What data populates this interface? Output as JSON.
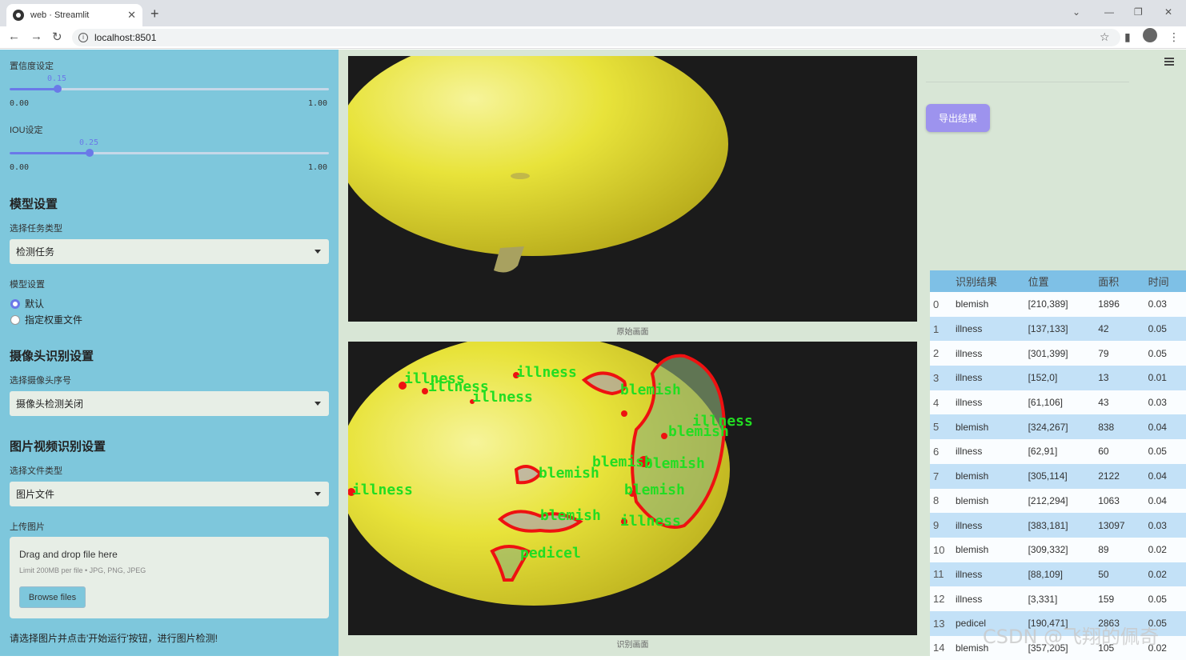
{
  "browser": {
    "tab_title": "web · Streamlit",
    "url": "localhost:8501"
  },
  "sidebar": {
    "confidence": {
      "label": "置信度设定",
      "value": 0.15,
      "value_text": "0.15",
      "min": "0.00",
      "max": "1.00"
    },
    "iou": {
      "label": "IOU设定",
      "value": 0.25,
      "value_text": "0.25",
      "min": "0.00",
      "max": "1.00"
    },
    "model_section": {
      "title": "模型设置",
      "task_label": "选择任务类型",
      "task_value": "检测任务",
      "weights_label": "模型设置",
      "options": [
        "默认",
        "指定权重文件"
      ],
      "selected": 0
    },
    "camera_section": {
      "title": "摄像头识别设置",
      "camera_label": "选择摄像头序号",
      "camera_value": "摄像头检测关闭"
    },
    "media_section": {
      "title": "图片视频识别设置",
      "file_type_label": "选择文件类型",
      "file_type_value": "图片文件",
      "upload_label": "上传图片",
      "upload_drag": "Drag and drop file here",
      "upload_limit": "Limit 200MB per file • JPG, PNG, JPEG",
      "browse_button": "Browse files"
    },
    "hint": "请选择图片并点击'开始运行'按钮，进行图片检测!"
  },
  "main": {
    "original_caption": "原始画面",
    "result_caption": "识别画面",
    "export_button": "导出结果",
    "detections": [
      {
        "text": "illness",
        "color": "#22dd22"
      },
      {
        "text": "illness",
        "color": "#22dd22"
      },
      {
        "text": "illness",
        "color": "#22dd22"
      },
      {
        "text": "blemish",
        "color": "#22dd22"
      },
      {
        "text": "illness",
        "color": "#22dd22"
      },
      {
        "text": "blemish",
        "color": "#22dd22"
      },
      {
        "text": "blemish",
        "color": "#22dd22"
      },
      {
        "text": "blemish",
        "color": "#22dd22"
      },
      {
        "text": "illness",
        "color": "#22dd22"
      },
      {
        "text": "blemish",
        "color": "#22dd22"
      },
      {
        "text": "blemish",
        "color": "#22dd22"
      },
      {
        "text": "illness",
        "color": "#22dd22"
      },
      {
        "text": "pedicel",
        "color": "#22dd22"
      },
      {
        "text": "blemish",
        "color": "#22dd22"
      },
      {
        "text": "illness",
        "color": "#22dd22"
      }
    ]
  },
  "table": {
    "headers": [
      "",
      "识别结果",
      "位置",
      "面积",
      "时间"
    ],
    "rows": [
      [
        "0",
        "blemish",
        "[210,389]",
        "1896",
        "0.03"
      ],
      [
        "1",
        "illness",
        "[137,133]",
        "42",
        "0.05"
      ],
      [
        "2",
        "illness",
        "[301,399]",
        "79",
        "0.05"
      ],
      [
        "3",
        "illness",
        "[152,0]",
        "13",
        "0.01"
      ],
      [
        "4",
        "illness",
        "[61,106]",
        "43",
        "0.03"
      ],
      [
        "5",
        "blemish",
        "[324,267]",
        "838",
        "0.04"
      ],
      [
        "6",
        "illness",
        "[62,91]",
        "60",
        "0.05"
      ],
      [
        "7",
        "blemish",
        "[305,114]",
        "2122",
        "0.04"
      ],
      [
        "8",
        "blemish",
        "[212,294]",
        "1063",
        "0.04"
      ],
      [
        "9",
        "illness",
        "[383,181]",
        "13097",
        "0.03"
      ],
      [
        "10",
        "blemish",
        "[309,332]",
        "89",
        "0.02"
      ],
      [
        "11",
        "illness",
        "[88,109]",
        "50",
        "0.02"
      ],
      [
        "12",
        "illness",
        "[3,331]",
        "159",
        "0.05"
      ],
      [
        "13",
        "pedicel",
        "[190,471]",
        "2863",
        "0.05"
      ],
      [
        "14",
        "blemish",
        "[357,205]",
        "105",
        "0.02"
      ]
    ]
  },
  "watermark": "CSDN @飞翔的佩奇"
}
